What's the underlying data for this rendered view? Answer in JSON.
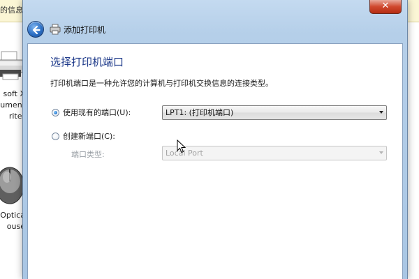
{
  "background": {
    "infobar_text": "的信息。",
    "devices": [
      {
        "label_lines": [
          "soft X",
          "ument",
          "riter"
        ],
        "icon": "printer-icon"
      },
      {
        "label_lines": [
          "Optica",
          "ouse"
        ],
        "icon": "mouse-icon"
      }
    ]
  },
  "dialog": {
    "title_bar_text": "",
    "close_button": "✕",
    "nav_title": "添加打印机",
    "heading": "选择打印机端口",
    "description": "打印机端口是一种允许您的计算机与打印机交换信息的连接类型。",
    "use_existing": {
      "label": "使用现有的端口(U):",
      "checked": true,
      "selected_value": "LPT1: (打印机端口)"
    },
    "create_new": {
      "label": "创建新端口(C):",
      "checked": false,
      "port_type_label": "端口类型:",
      "port_type_value": "Local Port"
    }
  },
  "colors": {
    "heading": "#1e3a8a",
    "frame": "#b5cfe9",
    "infobar": "#fbf6d5",
    "disabled_text": "#9aa0a6"
  }
}
